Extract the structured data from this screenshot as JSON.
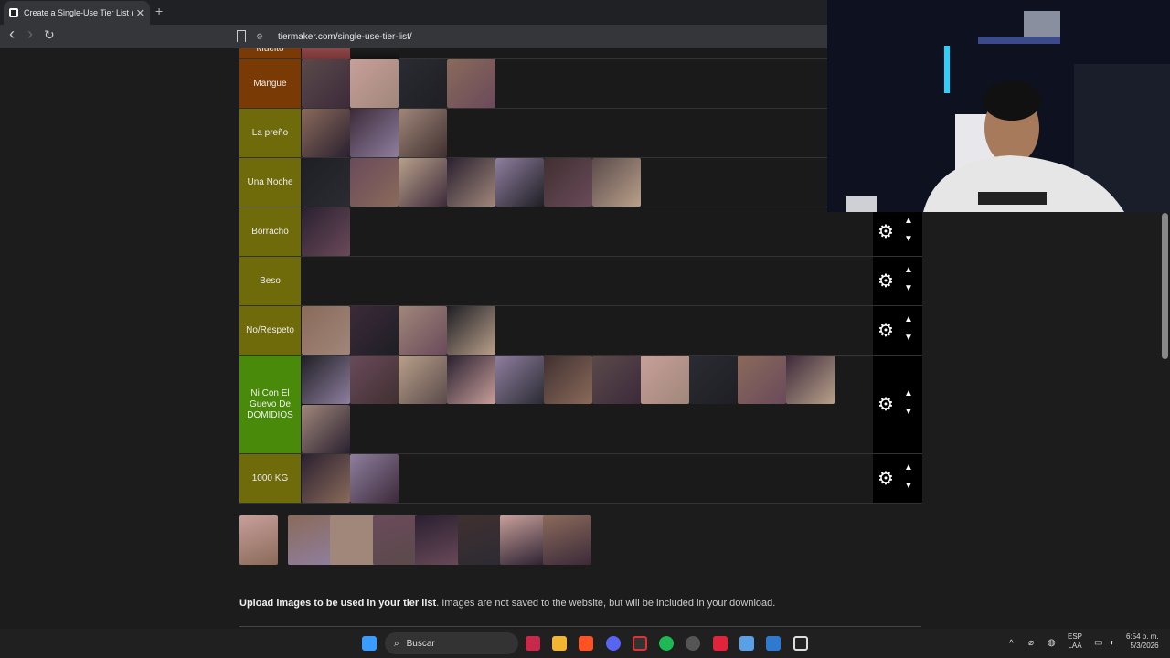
{
  "browser": {
    "tab_title": "Create a Single-Use Tier List (Pr",
    "tab_close": "✕",
    "new_tab": "+",
    "url": "tiermaker.com/single-use-tier-list/",
    "back": "‹",
    "forward": "›",
    "reload": "↻"
  },
  "tiers": [
    {
      "label": "Mangue",
      "color": "#7a3a05",
      "images": 4
    },
    {
      "label": "La preño",
      "color": "#6f6a0a",
      "images": 3
    },
    {
      "label": "Una Noche",
      "color": "#6f6a0a",
      "images": 7
    },
    {
      "label": "Borracho",
      "color": "#6f6a0a",
      "images": 1
    },
    {
      "label": "Beso",
      "color": "#6f6a0a",
      "images": 0
    },
    {
      "label": "No/Respeto",
      "color": "#6f6a0a",
      "images": 4
    },
    {
      "label": "Ni Con El Guevo De DOMIDIOS",
      "color": "#4a8a0a",
      "images": 12
    },
    {
      "label": "1000 KG",
      "color": "#6f6a0a",
      "images": 2
    }
  ],
  "partial_top_label": "Mueito",
  "controls": {
    "gear": "⚙",
    "up": "▲",
    "down": "▼"
  },
  "upload": {
    "bold": "Upload images to be used in your tier list",
    "rest": ". Images are not saved to the website, but will be included in your download."
  },
  "taskbar": {
    "search_placeholder": "Buscar",
    "lang_top": "ESP",
    "lang_bottom": "LAA",
    "time": "6:54 p. m.",
    "date": "5/3/2026"
  }
}
